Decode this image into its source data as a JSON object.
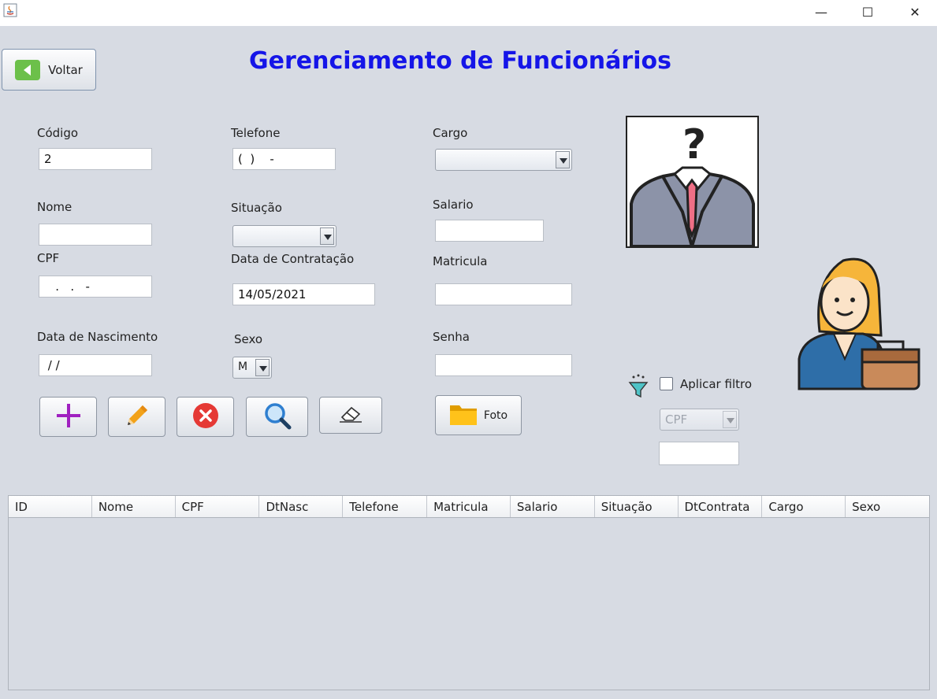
{
  "window": {
    "controls": {
      "minimize": "—",
      "maximize": "☐",
      "close": "✕"
    }
  },
  "header": {
    "back_label": "Voltar",
    "title": "Gerenciamento de Funcionários"
  },
  "form": {
    "codigo": {
      "label": "Código",
      "value": "2"
    },
    "telefone": {
      "label": "Telefone",
      "value": "(  )    -"
    },
    "cargo": {
      "label": "Cargo",
      "value": ""
    },
    "nome": {
      "label": "Nome",
      "value": ""
    },
    "situacao": {
      "label": "Situação",
      "value": ""
    },
    "salario": {
      "label": "Salario",
      "value": ""
    },
    "cpf": {
      "label": "CPF",
      "value": "   .   .   -"
    },
    "data_contratacao": {
      "label": "Data de Contratação",
      "value": "14/05/2021"
    },
    "matricula": {
      "label": "Matricula",
      "value": ""
    },
    "data_nascimento": {
      "label": "Data de Nascimento",
      "value": " / /"
    },
    "sexo": {
      "label": "Sexo",
      "value": "M"
    },
    "senha": {
      "label": "Senha",
      "value": ""
    }
  },
  "actions": {
    "foto_label": "Foto"
  },
  "filter": {
    "checkbox_label": "Aplicar filtro",
    "field_value": "CPF",
    "input_value": ""
  },
  "table": {
    "columns": [
      "ID",
      "Nome",
      "CPF",
      "DtNasc",
      "Telefone",
      "Matricula",
      "Salario",
      "Situação",
      "DtContrata",
      "Cargo",
      "Sexo"
    ]
  },
  "colors": {
    "title": "#1515e8",
    "background": "#d7dbe3",
    "add_icon": "#a020c0",
    "edit_icon": "#f2a21a",
    "delete_icon": "#e53935",
    "search_icon": "#2f7fd0",
    "folder_icon": "#f5b400",
    "back_icon": "#6cc04a"
  }
}
